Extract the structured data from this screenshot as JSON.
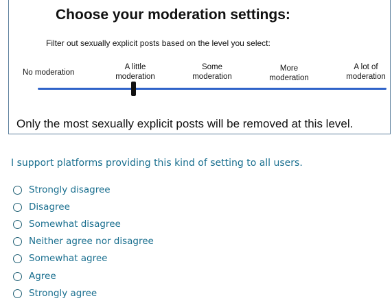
{
  "settings": {
    "title": "Choose your moderation settings:",
    "subtitle": "Filter out sexually explicit posts based on the level you select:",
    "levels": [
      {
        "line1": "No moderation",
        "line2": ""
      },
      {
        "line1": "A little",
        "line2": "moderation"
      },
      {
        "line1": "Some",
        "line2": "moderation"
      },
      {
        "line1": "More",
        "line2": "moderation"
      },
      {
        "line1": "A lot of",
        "line2": "moderation"
      }
    ],
    "selected_level": "A little moderation",
    "selected_index": 1,
    "caption": "Only the most sexually explicit posts will be removed at this level."
  },
  "survey": {
    "question": "I support platforms providing this kind of setting to all users.",
    "options": [
      "Strongly disagree",
      "Disagree",
      "Somewhat disagree",
      "Neither agree nor disagree",
      "Somewhat agree",
      "Agree",
      "Strongly agree"
    ],
    "selected_option": null
  },
  "colors": {
    "track": "#2f63c9",
    "accent_text": "#1a6f8f",
    "panel_border": "#5c7f9c"
  }
}
